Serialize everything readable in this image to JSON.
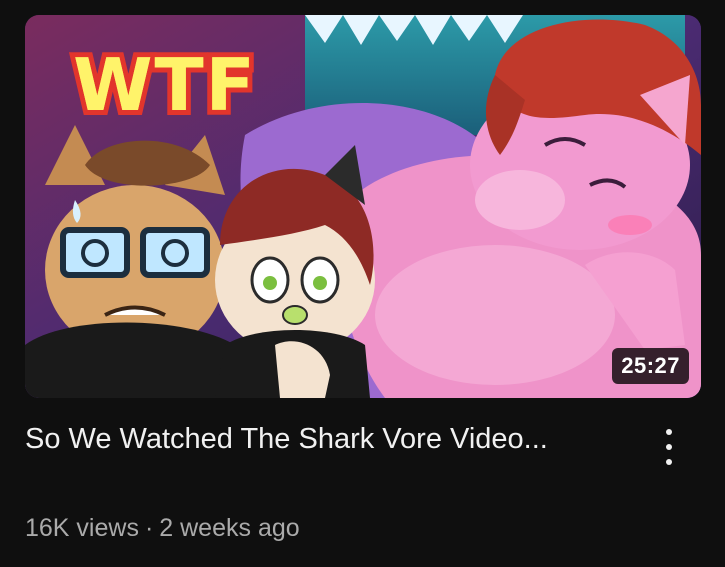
{
  "video": {
    "duration": "25:27",
    "title": "So We Watched The Shark Vore Video...",
    "views": "16K views",
    "separator": "·",
    "age": "2 weeks ago",
    "thumbnail_text": "WTF"
  },
  "icons": {
    "more": "more-vert-icon"
  },
  "colors": {
    "background": "#0f0f0f",
    "title": "#f1f1f1",
    "meta": "#aaaaaa",
    "badge_bg": "#000000"
  }
}
